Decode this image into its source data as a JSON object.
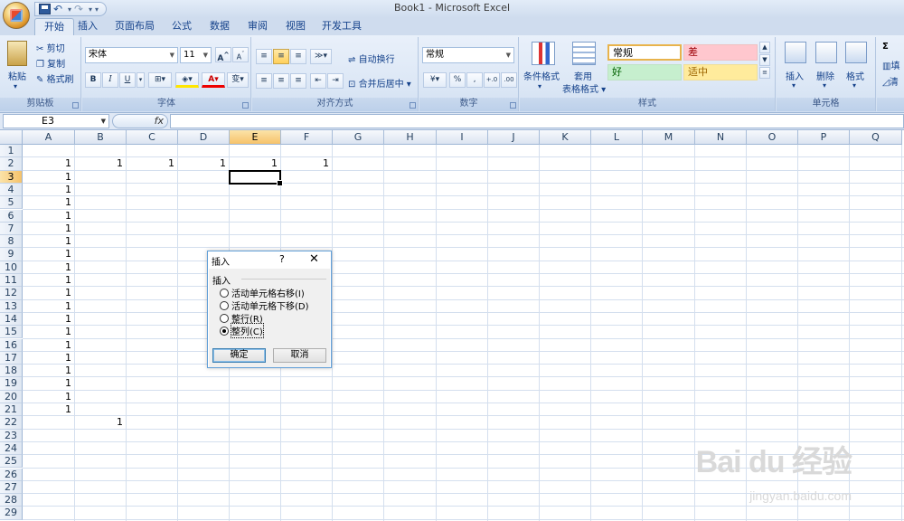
{
  "window": {
    "title": "Book1 - Microsoft Excel"
  },
  "tabs": [
    "开始",
    "插入",
    "页面布局",
    "公式",
    "数据",
    "审阅",
    "视图",
    "开发工具"
  ],
  "clipboard": {
    "paste": "粘贴",
    "cut": "剪切",
    "copy": "复制",
    "format_painter": "格式刷",
    "label": "剪贴板"
  },
  "font": {
    "name": "宋体",
    "size": "11",
    "grow": "A",
    "shrink": "A",
    "bold": "B",
    "italic": "I",
    "underline": "U",
    "font_color": "A",
    "wen": "变",
    "label": "字体"
  },
  "alignment": {
    "wrap": "自动换行",
    "merge": "合并后居中",
    "label": "对齐方式"
  },
  "number": {
    "format": "常规",
    "percent": "%",
    "comma": ",",
    "inc": "+.0",
    "dec": ".00",
    "label": "数字"
  },
  "styles": {
    "conditional": "条件格式",
    "table_fmt": "套用",
    "table_fmt2": "表格格式",
    "normal": "常规",
    "bad": "差",
    "good": "好",
    "neutral": "适中",
    "label": "样式"
  },
  "cells_group": {
    "insert": "插入",
    "delete": "删除",
    "format": "格式",
    "label": "单元格"
  },
  "editing": {
    "sigma": "Σ",
    "fill": "填",
    "clear": "清"
  },
  "formula_bar": {
    "name_box": "E3",
    "fx": "fx",
    "value": ""
  },
  "grid": {
    "columns": [
      "A",
      "B",
      "C",
      "D",
      "E",
      "F",
      "G",
      "H",
      "I",
      "J",
      "K",
      "L",
      "M",
      "N",
      "O",
      "P",
      "Q"
    ],
    "rows": [
      "1",
      "2",
      "3",
      "4",
      "5",
      "6",
      "7",
      "8",
      "9",
      "10",
      "11",
      "12",
      "13",
      "14",
      "15",
      "16",
      "17",
      "18",
      "19",
      "20",
      "21",
      "22",
      "23",
      "24",
      "25",
      "26",
      "27",
      "28",
      "29"
    ],
    "selected_cell": "E3",
    "values": [
      {
        "cell": "A2",
        "v": "1"
      },
      {
        "cell": "B2",
        "v": "1"
      },
      {
        "cell": "C2",
        "v": "1"
      },
      {
        "cell": "D2",
        "v": "1"
      },
      {
        "cell": "E2",
        "v": "1"
      },
      {
        "cell": "F2",
        "v": "1"
      },
      {
        "cell": "A3",
        "v": "1"
      },
      {
        "cell": "A4",
        "v": "1"
      },
      {
        "cell": "A5",
        "v": "1"
      },
      {
        "cell": "A6",
        "v": "1"
      },
      {
        "cell": "A7",
        "v": "1"
      },
      {
        "cell": "A8",
        "v": "1"
      },
      {
        "cell": "A9",
        "v": "1"
      },
      {
        "cell": "A10",
        "v": "1"
      },
      {
        "cell": "A11",
        "v": "1"
      },
      {
        "cell": "A12",
        "v": "1"
      },
      {
        "cell": "A13",
        "v": "1"
      },
      {
        "cell": "A14",
        "v": "1"
      },
      {
        "cell": "A15",
        "v": "1"
      },
      {
        "cell": "A16",
        "v": "1"
      },
      {
        "cell": "A17",
        "v": "1"
      },
      {
        "cell": "A18",
        "v": "1"
      },
      {
        "cell": "A19",
        "v": "1"
      },
      {
        "cell": "A20",
        "v": "1"
      },
      {
        "cell": "A21",
        "v": "1"
      },
      {
        "cell": "B22",
        "v": "1"
      }
    ]
  },
  "dialog": {
    "title": "插入",
    "help": "?",
    "close": "✕",
    "group_label": "插入",
    "options": [
      {
        "label": "活动单元格右移(I)",
        "selected": false
      },
      {
        "label": "活动单元格下移(D)",
        "selected": false
      },
      {
        "label": "整行(R)",
        "selected": false
      },
      {
        "label": "整列(C)",
        "selected": true
      }
    ],
    "ok": "确定",
    "cancel": "取消"
  },
  "watermark": {
    "brand": "Bai  du 经验",
    "url": "jingyan.baidu.com"
  },
  "colors": {
    "accent": "#15428b",
    "selected_header": "#f6c26a",
    "dialog_border": "#62a0d8"
  }
}
